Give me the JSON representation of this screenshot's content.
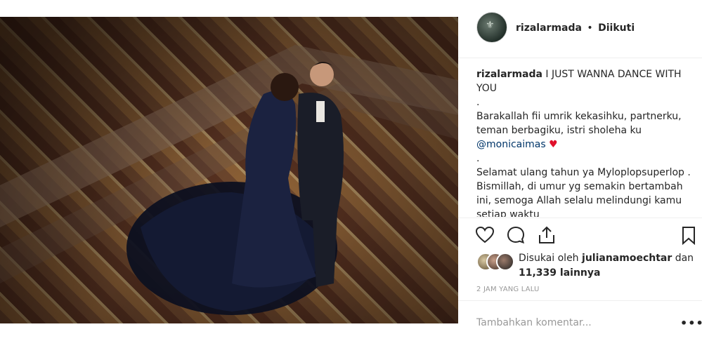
{
  "post": {
    "username": "rizalarmada",
    "separator": "•",
    "follow_status": "Diikuti",
    "caption": {
      "username": "rizalarmada",
      "line1": "I JUST WANNA DANCE WITH YOU",
      "dot1": ".",
      "line2": "Barakallah fii umrik kekasihku, partnerku, teman berbagiku, istri sholeha ku",
      "mention": "@monicaimas",
      "heart": "♥",
      "dot2": ".",
      "line3": "Selamat ulang tahun ya Myloplopsuperlop . Bismillah, di umur yg semakin bertambah ini, semoga Allah selalu melindungi kamu setiap waktu"
    },
    "likes": {
      "prefix": "Disukai oleh",
      "user": "julianamoechtar",
      "joiner": "dan",
      "count": "11,339 lainnya"
    },
    "timestamp": "2 JAM YANG LALU",
    "comment_placeholder": "Tambahkan komentar...",
    "more_label": "•••"
  },
  "icons": {
    "like": "heart-outline-icon",
    "comment": "speech-bubble-icon",
    "share": "share-arrow-icon",
    "save": "bookmark-icon"
  }
}
